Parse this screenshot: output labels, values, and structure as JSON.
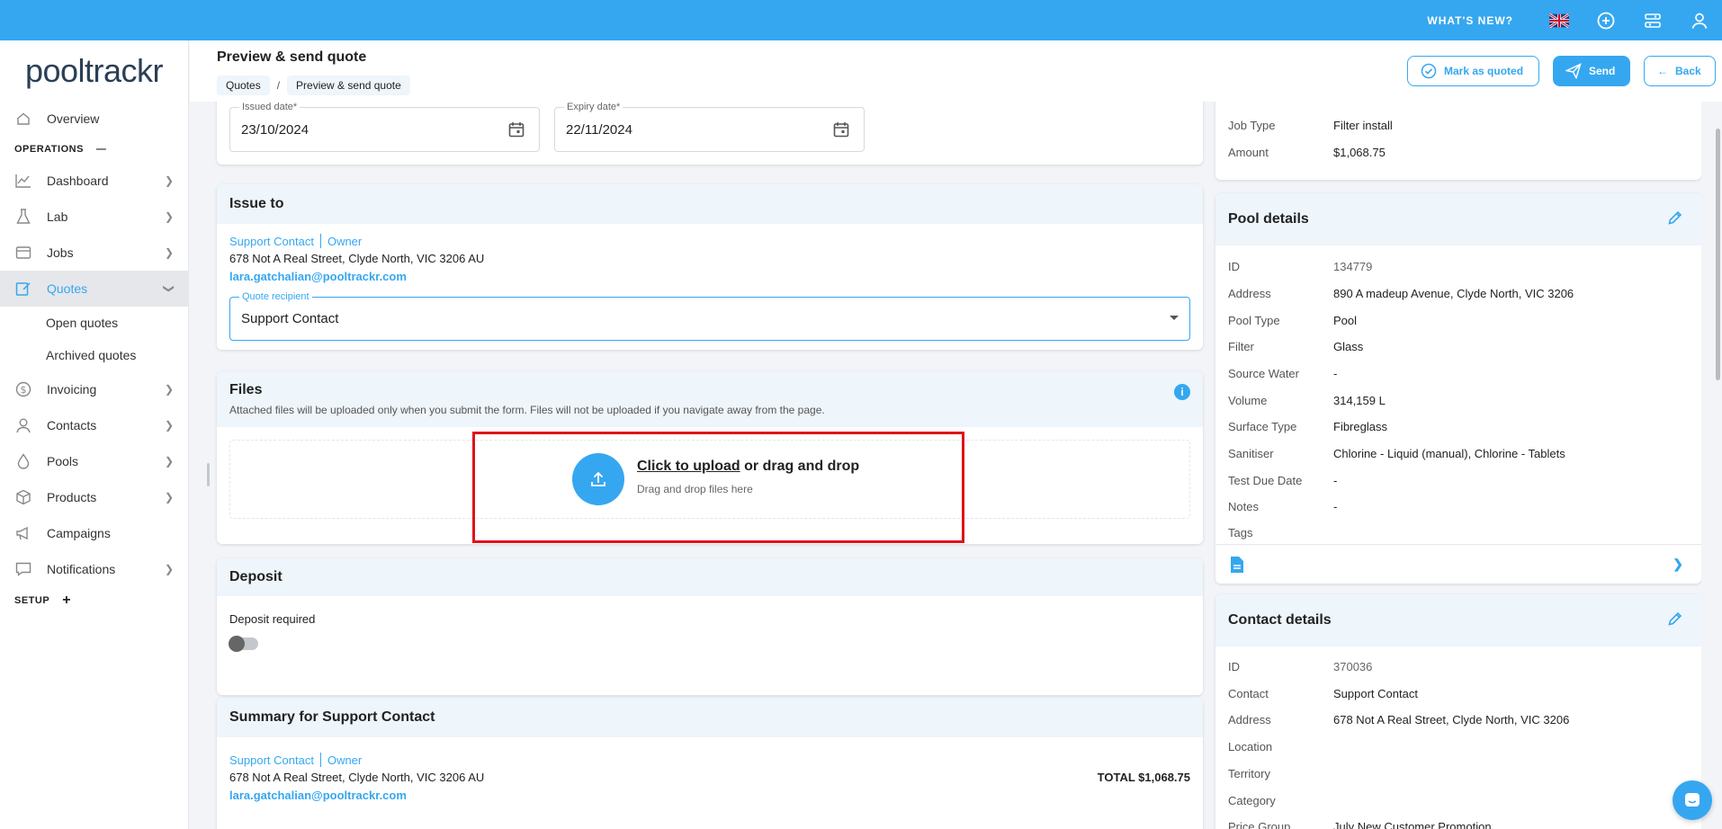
{
  "topbar": {
    "whats_new": "WHAT'S NEW?"
  },
  "brand": {
    "logo": "pooltrackr"
  },
  "sidebar": {
    "overview": "Overview",
    "operations": "OPERATIONS",
    "dashboard": "Dashboard",
    "lab": "Lab",
    "jobs": "Jobs",
    "quotes": "Quotes",
    "open_quotes": "Open quotes",
    "archived_quotes": "Archived quotes",
    "invoicing": "Invoicing",
    "contacts": "Contacts",
    "pools": "Pools",
    "products": "Products",
    "campaigns": "Campaigns",
    "notifications": "Notifications",
    "setup": "SETUP"
  },
  "header": {
    "title": "Preview & send quote",
    "breadcrumbs": [
      "Quotes",
      "Preview & send quote"
    ],
    "mark_quoted": "Mark as quoted",
    "send": "Send",
    "back": "Back"
  },
  "dates": {
    "issued_label": "Issued date",
    "issued_value": "23/10/2024",
    "expiry_label": "Expiry date",
    "expiry_value": "22/11/2024"
  },
  "issue_to": {
    "title": "Issue to",
    "contact_name": "Support Contact",
    "contact_role": "Owner",
    "address": "678 Not A Real Street, Clyde North, VIC 3206 AU",
    "email": "lara.gatchalian@pooltrackr.com",
    "recipient_label": "Quote recipient",
    "recipient_value": "Support Contact"
  },
  "files": {
    "title": "Files",
    "subtitle": "Attached files will be uploaded only when you submit the form. Files will not be uploaded if you navigate away from the page.",
    "upload_link": "Click to upload",
    "upload_rest": " or drag and drop",
    "upload_hint": "Drag and drop files here"
  },
  "deposit": {
    "title": "Deposit",
    "required_label": "Deposit required",
    "required": false
  },
  "summary": {
    "title": "Summary for Support Contact",
    "contact_name": "Support Contact",
    "contact_role": "Owner",
    "address": "678 Not A Real Street, Clyde North, VIC 3206 AU",
    "email": "lara.gatchalian@pooltrackr.com",
    "total": "TOTAL $1,068.75"
  },
  "job_summary": {
    "rows": [
      {
        "k": "Job Type",
        "v": "Filter install"
      },
      {
        "k": "Amount",
        "v": "$1,068.75"
      }
    ]
  },
  "pool_details": {
    "title": "Pool details",
    "rows": [
      {
        "k": "ID",
        "v": "134779"
      },
      {
        "k": "Address",
        "v": "890 A madeup Avenue, Clyde North, VIC 3206"
      },
      {
        "k": "Pool Type",
        "v": "Pool"
      },
      {
        "k": "Filter",
        "v": "Glass"
      },
      {
        "k": "Source Water",
        "v": "-"
      },
      {
        "k": "Volume",
        "v": "314,159 L"
      },
      {
        "k": "Surface Type",
        "v": "Fibreglass"
      },
      {
        "k": "Sanitiser",
        "v": "Chlorine - Liquid (manual), Chlorine - Tablets"
      },
      {
        "k": "Test Due Date",
        "v": "-"
      },
      {
        "k": "Notes",
        "v": "-"
      },
      {
        "k": "Tags",
        "v": ""
      }
    ]
  },
  "contact_details": {
    "title": "Contact details",
    "rows": [
      {
        "k": "ID",
        "v": "370036"
      },
      {
        "k": "Contact",
        "v": "Support Contact"
      },
      {
        "k": "Address",
        "v": "678 Not A Real Street, Clyde North, VIC 3206"
      },
      {
        "k": "Location",
        "v": ""
      },
      {
        "k": "Territory",
        "v": ""
      },
      {
        "k": "Category",
        "v": ""
      },
      {
        "k": "Price Group",
        "v": "July New Customer Promotion"
      }
    ]
  },
  "colors": {
    "accent": "#35a7f0",
    "highlight": "#e0131a"
  }
}
